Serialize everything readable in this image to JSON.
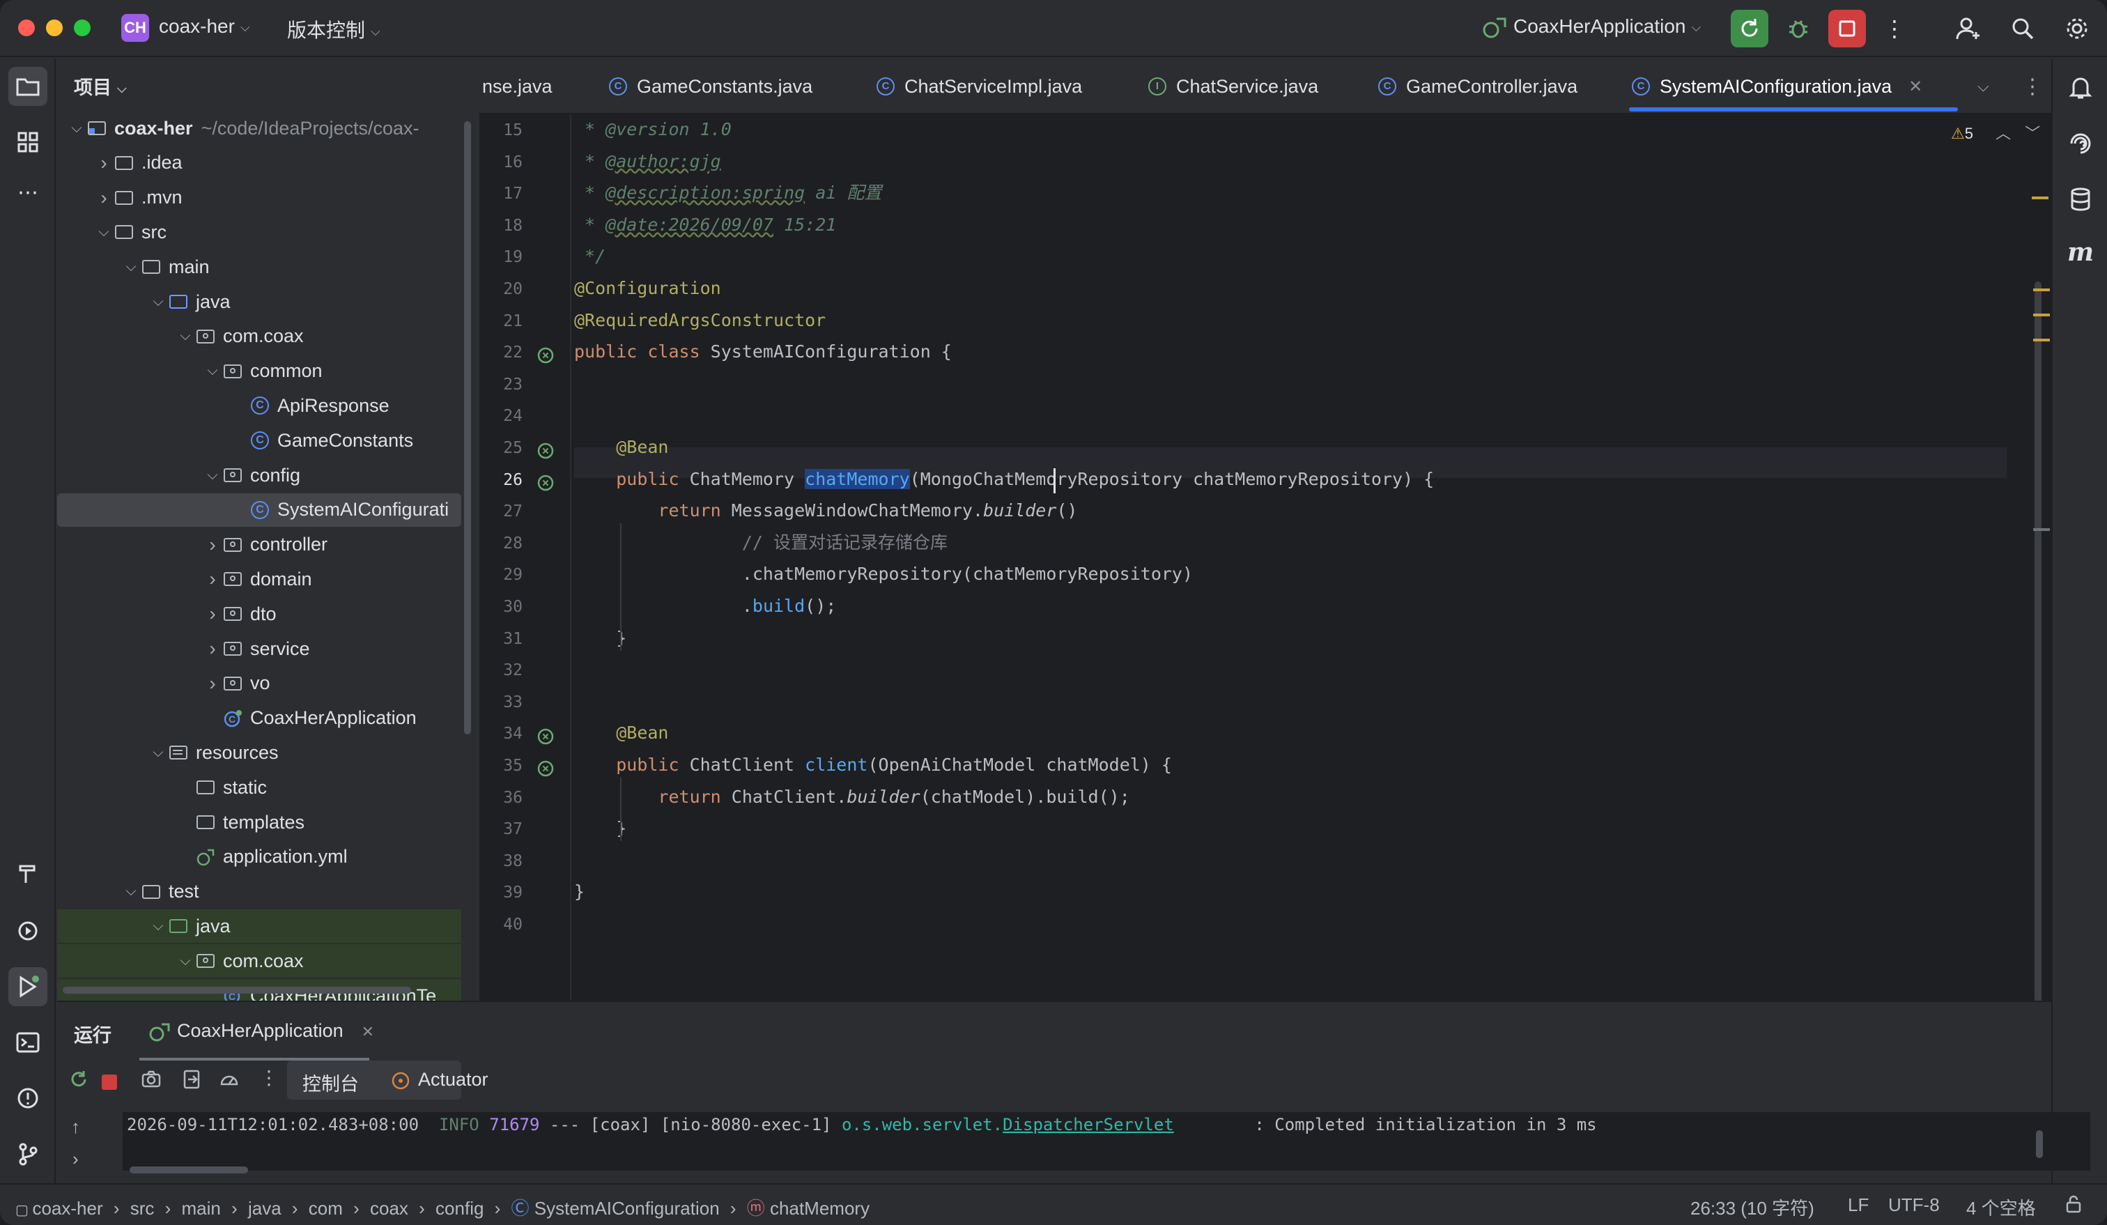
{
  "titlebar": {
    "project_badge": "CH",
    "project_name": "coax-her",
    "vcs_label": "版本控制",
    "run_config": "CoaxHerApplication"
  },
  "project_panel": {
    "title": "项目",
    "tree": [
      {
        "label": "coax-her",
        "path": "~/code/IdeaProjects/coax-",
        "kind": "module",
        "depth": 0,
        "expanded": true
      },
      {
        "label": ".idea",
        "kind": "folder",
        "depth": 1,
        "expanded": false
      },
      {
        "label": ".mvn",
        "kind": "folder",
        "depth": 1,
        "expanded": false
      },
      {
        "label": "src",
        "kind": "folder",
        "depth": 1,
        "expanded": true
      },
      {
        "label": "main",
        "kind": "folder",
        "depth": 2,
        "expanded": true
      },
      {
        "label": "java",
        "kind": "source-folder",
        "depth": 3,
        "expanded": true
      },
      {
        "label": "com.coax",
        "kind": "package",
        "depth": 4,
        "expanded": true
      },
      {
        "label": "common",
        "kind": "package",
        "depth": 5,
        "expanded": true
      },
      {
        "label": "ApiResponse",
        "kind": "class",
        "depth": 6
      },
      {
        "label": "GameConstants",
        "kind": "class",
        "depth": 6
      },
      {
        "label": "config",
        "kind": "package",
        "depth": 5,
        "expanded": true
      },
      {
        "label": "SystemAIConfigurati",
        "kind": "class",
        "depth": 6,
        "selected": true
      },
      {
        "label": "controller",
        "kind": "package",
        "depth": 5,
        "expanded": false
      },
      {
        "label": "domain",
        "kind": "package",
        "depth": 5,
        "expanded": false
      },
      {
        "label": "dto",
        "kind": "package",
        "depth": 5,
        "expanded": false
      },
      {
        "label": "service",
        "kind": "package",
        "depth": 5,
        "expanded": false
      },
      {
        "label": "vo",
        "kind": "package",
        "depth": 5,
        "expanded": false
      },
      {
        "label": "CoaxHerApplication",
        "kind": "spring-class",
        "depth": 5
      },
      {
        "label": "resources",
        "kind": "resources",
        "depth": 3,
        "expanded": true
      },
      {
        "label": "static",
        "kind": "folder",
        "depth": 4
      },
      {
        "label": "templates",
        "kind": "folder",
        "depth": 4
      },
      {
        "label": "application.yml",
        "kind": "yml",
        "depth": 4
      },
      {
        "label": "test",
        "kind": "folder",
        "depth": 2,
        "expanded": true
      },
      {
        "label": "java",
        "kind": "test-folder",
        "depth": 3,
        "expanded": true,
        "test": true
      },
      {
        "label": "com.coax",
        "kind": "package",
        "depth": 4,
        "expanded": true,
        "test": true
      },
      {
        "label": "CoaxHerApplicationTe",
        "kind": "spring-class",
        "depth": 5,
        "test": true
      }
    ]
  },
  "tabs": [
    {
      "label": "nse.java",
      "icon": "class-icon"
    },
    {
      "label": "GameConstants.java",
      "icon": "class-icon"
    },
    {
      "label": "ChatServiceImpl.java",
      "icon": "class-icon"
    },
    {
      "label": "ChatService.java",
      "icon": "interface-icon"
    },
    {
      "label": "GameController.java",
      "icon": "class-icon"
    },
    {
      "label": "SystemAIConfiguration.java",
      "icon": "class-icon",
      "active": true
    }
  ],
  "editor": {
    "warning_count": "5",
    "current_line": 26,
    "lines": [
      {
        "n": "15",
        "html": "<span class=\"cd\"> * @version 1.0</span>"
      },
      {
        "n": "16",
        "html": "<span class=\"cd\"> * </span><span class=\"cdt\">@author:gjg</span>"
      },
      {
        "n": "17",
        "html": "<span class=\"cd\"> * </span><span class=\"cdt\">@description:spring</span><span class=\"cd\"> ai 配置</span>"
      },
      {
        "n": "18",
        "html": "<span class=\"cd\"> * </span><span class=\"cdt\">@date:2026/09/07</span><span class=\"cd\"> 15:21</span>"
      },
      {
        "n": "19",
        "html": "<span class=\"cd\"> */</span>"
      },
      {
        "n": "20",
        "html": "<span class=\"a\">@Configuration</span>"
      },
      {
        "n": "21",
        "html": "<span class=\"a\">@RequiredArgsConstructor</span>"
      },
      {
        "n": "22",
        "html": "<span class=\"k\">public class </span><span class=\"p\">SystemAIConfiguration {</span>"
      },
      {
        "n": "23",
        "html": ""
      },
      {
        "n": "24",
        "html": ""
      },
      {
        "n": "25",
        "html": "    <span class=\"a\">@Bean</span>"
      },
      {
        "n": "26",
        "html": "    <span class=\"k\">public </span><span class=\"p\">ChatMemory </span><span class=\"sel\">chatMemory</span><span class=\"p\">(MongoChatMemoryRepository chatMemoryRepository) {</span>"
      },
      {
        "n": "27",
        "html": "        <span class=\"k\">return </span><span class=\"p\">MessageWindowChatMemory.</span><span class=\"p it\">builder</span><span class=\"p\">()</span>"
      },
      {
        "n": "28",
        "html": "                <span class=\"c\">// 设置对话记录存储仓库</span>"
      },
      {
        "n": "29",
        "html": "                <span class=\"p\">.chatMemoryRepository(chatMemoryRepository)</span>"
      },
      {
        "n": "30",
        "html": "                <span class=\"p\">.</span><span class=\"f\">build</span><span class=\"p\">();</span>"
      },
      {
        "n": "31",
        "html": "    <span class=\"p\">}</span>"
      },
      {
        "n": "32",
        "html": ""
      },
      {
        "n": "33",
        "html": ""
      },
      {
        "n": "34",
        "html": "    <span class=\"a\">@Bean</span>"
      },
      {
        "n": "35",
        "html": "    <span class=\"k\">public </span><span class=\"p\">ChatClient </span><span class=\"f\">client</span><span class=\"p\">(OpenAiChatModel chatModel) {</span>"
      },
      {
        "n": "36",
        "html": "        <span class=\"k\">return </span><span class=\"p\">ChatClient.</span><span class=\"p it\">builder</span><span class=\"p\">(chatModel).build();</span>"
      },
      {
        "n": "37",
        "html": "    <span class=\"p\">}</span>"
      },
      {
        "n": "38",
        "html": ""
      },
      {
        "n": "39",
        "html": "<span class=\"p\">}</span>"
      },
      {
        "n": "40",
        "html": ""
      }
    ],
    "gutter_icons": [
      {
        "line": "22",
        "name": "spring-bean-icon"
      },
      {
        "line": "25",
        "name": "spring-bean-icon"
      },
      {
        "line": "26",
        "name": "spring-bean-icon"
      },
      {
        "line": "34",
        "name": "spring-bean-icon"
      },
      {
        "line": "35",
        "name": "spring-bean-icon"
      }
    ]
  },
  "run_panel": {
    "title": "运行",
    "config_tab": "CoaxHerApplication",
    "console_tab": "控制台",
    "actuator_tab": "Actuator",
    "log": {
      "timestamp": "2026-09-11T12:01:02.483+08:00",
      "level": "INFO",
      "pid": "71679",
      "sep": "---",
      "thread": "[coax] [nio-8080-exec-1]",
      "logger_prefix": "o.s.web.servlet.",
      "logger_class": "DispatcherServlet",
      "message": ": Completed initialization in 3 ms"
    }
  },
  "statusbar": {
    "breadcrumbs": [
      "coax-her",
      "src",
      "main",
      "java",
      "com",
      "coax",
      "config",
      "SystemAIConfiguration",
      "chatMemory"
    ],
    "position": "26:33 (10 字符)",
    "line_sep": "LF",
    "encoding": "UTF-8",
    "indent": "4 个空格"
  },
  "colors": {
    "accent": "#3574f0",
    "run_green": "#3e8f4a",
    "stop_red": "#d13e3e",
    "warning": "#e5b53a"
  }
}
